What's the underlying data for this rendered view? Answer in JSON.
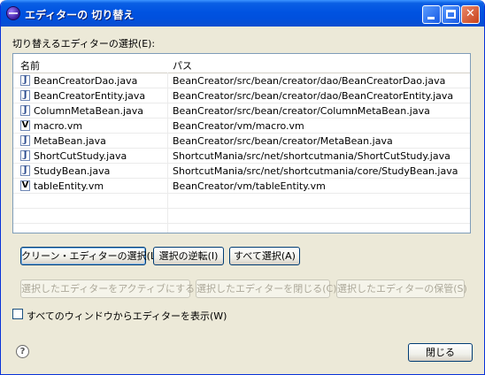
{
  "window": {
    "title": "エディターの 切り替え",
    "controls": {
      "minimize": "",
      "maximize": "",
      "close": "✕"
    }
  },
  "prompt_label": "切り替えるエディターの選択(E):",
  "table": {
    "headers": {
      "name": "名前",
      "path": "パス"
    },
    "rows": [
      {
        "icon": "J",
        "name": "BeanCreatorDao.java",
        "path": "BeanCreator/src/bean/creator/dao/BeanCreatorDao.java"
      },
      {
        "icon": "J",
        "name": "BeanCreatorEntity.java",
        "path": "BeanCreator/src/bean/creator/dao/BeanCreatorEntity.java"
      },
      {
        "icon": "J",
        "name": "ColumnMetaBean.java",
        "path": "BeanCreator/src/bean/creator/ColumnMetaBean.java"
      },
      {
        "icon": "V",
        "name": "macro.vm",
        "path": "BeanCreator/vm/macro.vm"
      },
      {
        "icon": "J",
        "name": "MetaBean.java",
        "path": "BeanCreator/src/bean/creator/MetaBean.java"
      },
      {
        "icon": "J",
        "name": "ShortCutStudy.java",
        "path": "ShortcutMania/src/net/shortcutmania/ShortCutStudy.java"
      },
      {
        "icon": "J",
        "name": "StudyBean.java",
        "path": "ShortcutMania/src/net/shortcutmania/core/StudyBean.java"
      },
      {
        "icon": "V",
        "name": "tableEntity.vm",
        "path": "BeanCreator/vm/tableEntity.vm"
      }
    ]
  },
  "buttons": {
    "select_clean": "クリーン・エディターの選択(L)",
    "invert_selection": "選択の逆転(I)",
    "select_all": "すべて選択(A)",
    "activate_selected": "選択したエディターをアクティブにする(T)",
    "close_selected": "選択したエディターを閉じる(C)",
    "save_selected": "選択したエディターの保管(S)",
    "close": "閉じる"
  },
  "checkbox": {
    "label": "すべてのウィンドウからエディターを表示(W)",
    "checked": false
  },
  "help_icon": "?"
}
